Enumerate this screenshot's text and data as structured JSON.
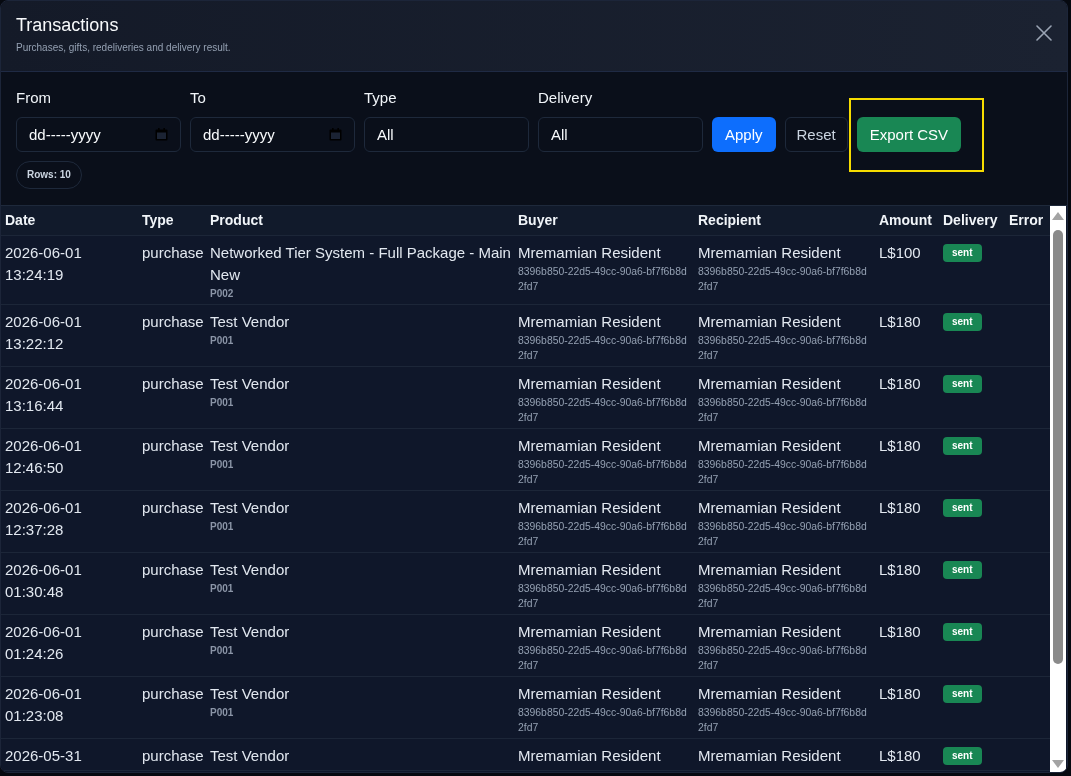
{
  "dialog": {
    "title": "Transactions",
    "subtitle": "Purchases, gifts, redeliveries and delivery result."
  },
  "filters": [
    {
      "kind": "date",
      "label": "From",
      "placeholder": "dd-----yyyy"
    },
    {
      "kind": "date",
      "label": "To",
      "placeholder": "dd-----yyyy"
    },
    {
      "kind": "select",
      "label": "Type",
      "value": "All"
    },
    {
      "kind": "select",
      "label": "Delivery",
      "value": "All"
    }
  ],
  "buttons": [
    {
      "kind": "primary",
      "label": "Apply",
      "highlighted": false
    },
    {
      "kind": "secondary",
      "label": "Reset",
      "highlighted": false
    },
    {
      "kind": "success",
      "label": "Export CSV",
      "highlighted": true
    }
  ],
  "row_count": "Rows: 10",
  "table": {
    "columns": [
      "Date",
      "Type",
      "Product",
      "Buyer",
      "Recipient",
      "Amount",
      "Delivery",
      "Error"
    ],
    "rows": [
      {
        "date": "2026-06-01 13:24:19",
        "type": "purchase",
        "product": "Networked Tier System - Full Package - Main New",
        "sku": "P002",
        "buyer": "Mremamian Resident",
        "buyer_id": "8396b850-22d5-49cc-90a6-bf7f6b8d2fd7",
        "recipient": "Mremamian Resident",
        "recipient_id": "8396b850-22d5-49cc-90a6-bf7f6b8d2fd7",
        "amount": "L$100",
        "delivery": "sent"
      },
      {
        "date": "2026-06-01 13:22:12",
        "type": "purchase",
        "product": "Test Vendor",
        "sku": "P001",
        "buyer": "Mremamian Resident",
        "buyer_id": "8396b850-22d5-49cc-90a6-bf7f6b8d2fd7",
        "recipient": "Mremamian Resident",
        "recipient_id": "8396b850-22d5-49cc-90a6-bf7f6b8d2fd7",
        "amount": "L$180",
        "delivery": "sent"
      },
      {
        "date": "2026-06-01 13:16:44",
        "type": "purchase",
        "product": "Test Vendor",
        "sku": "P001",
        "buyer": "Mremamian Resident",
        "buyer_id": "8396b850-22d5-49cc-90a6-bf7f6b8d2fd7",
        "recipient": "Mremamian Resident",
        "recipient_id": "8396b850-22d5-49cc-90a6-bf7f6b8d2fd7",
        "amount": "L$180",
        "delivery": "sent"
      },
      {
        "date": "2026-06-01 12:46:50",
        "type": "purchase",
        "product": "Test Vendor",
        "sku": "P001",
        "buyer": "Mremamian Resident",
        "buyer_id": "8396b850-22d5-49cc-90a6-bf7f6b8d2fd7",
        "recipient": "Mremamian Resident",
        "recipient_id": "8396b850-22d5-49cc-90a6-bf7f6b8d2fd7",
        "amount": "L$180",
        "delivery": "sent"
      },
      {
        "date": "2026-06-01 12:37:28",
        "type": "purchase",
        "product": "Test Vendor",
        "sku": "P001",
        "buyer": "Mremamian Resident",
        "buyer_id": "8396b850-22d5-49cc-90a6-bf7f6b8d2fd7",
        "recipient": "Mremamian Resident",
        "recipient_id": "8396b850-22d5-49cc-90a6-bf7f6b8d2fd7",
        "amount": "L$180",
        "delivery": "sent"
      },
      {
        "date": "2026-06-01 01:30:48",
        "type": "purchase",
        "product": "Test Vendor",
        "sku": "P001",
        "buyer": "Mremamian Resident",
        "buyer_id": "8396b850-22d5-49cc-90a6-bf7f6b8d2fd7",
        "recipient": "Mremamian Resident",
        "recipient_id": "8396b850-22d5-49cc-90a6-bf7f6b8d2fd7",
        "amount": "L$180",
        "delivery": "sent"
      },
      {
        "date": "2026-06-01 01:24:26",
        "type": "purchase",
        "product": "Test Vendor",
        "sku": "P001",
        "buyer": "Mremamian Resident",
        "buyer_id": "8396b850-22d5-49cc-90a6-bf7f6b8d2fd7",
        "recipient": "Mremamian Resident",
        "recipient_id": "8396b850-22d5-49cc-90a6-bf7f6b8d2fd7",
        "amount": "L$180",
        "delivery": "sent"
      },
      {
        "date": "2026-06-01 01:23:08",
        "type": "purchase",
        "product": "Test Vendor",
        "sku": "P001",
        "buyer": "Mremamian Resident",
        "buyer_id": "8396b850-22d5-49cc-90a6-bf7f6b8d2fd7",
        "recipient": "Mremamian Resident",
        "recipient_id": "8396b850-22d5-49cc-90a6-bf7f6b8d2fd7",
        "amount": "L$180",
        "delivery": "sent"
      },
      {
        "date": "2026-05-31",
        "type": "purchase",
        "product": "Test Vendor",
        "buyer": "Mremamian Resident",
        "recipient": "Mremamian Resident",
        "amount": "L$180",
        "delivery": "sent"
      }
    ]
  }
}
